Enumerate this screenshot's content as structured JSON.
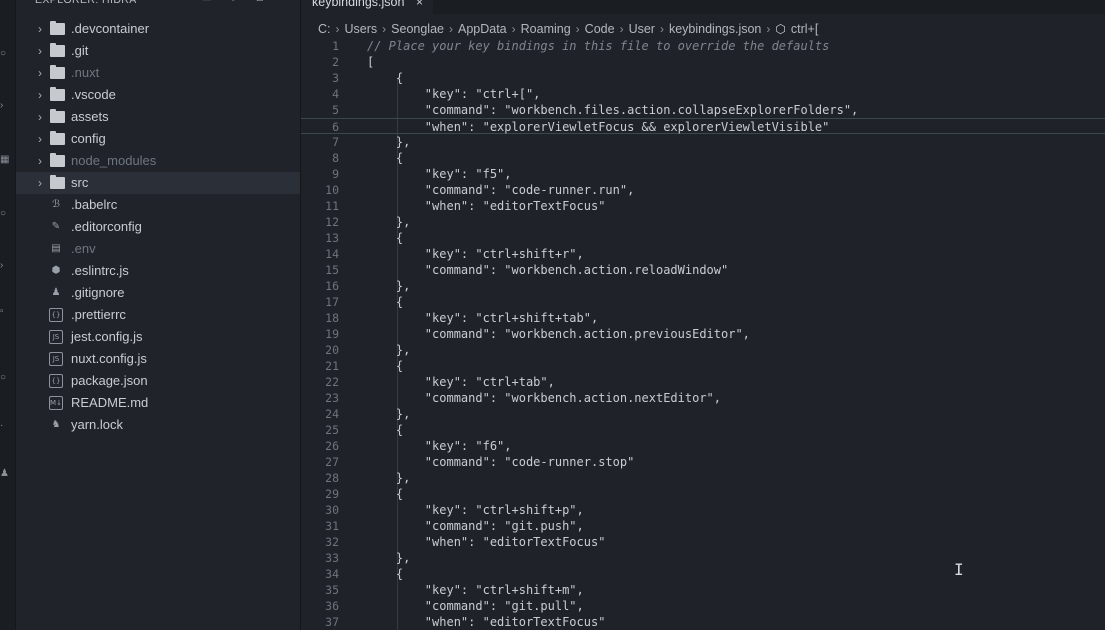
{
  "sidebar": {
    "title": "EXPLORER: HIDRA",
    "items": [
      {
        "label": ".devcontainer",
        "type": "folder",
        "dim": false
      },
      {
        "label": ".git",
        "type": "folder",
        "dim": false
      },
      {
        "label": ".nuxt",
        "type": "folder",
        "dim": true
      },
      {
        "label": ".vscode",
        "type": "folder",
        "dim": false
      },
      {
        "label": "assets",
        "type": "folder",
        "dim": false
      },
      {
        "label": "config",
        "type": "folder",
        "dim": false
      },
      {
        "label": "node_modules",
        "type": "folder",
        "dim": true
      },
      {
        "label": "src",
        "type": "folder",
        "dim": false,
        "selected": true
      },
      {
        "label": ".babelrc",
        "type": "file",
        "icon": "babel-icon",
        "glyph": "ℬ"
      },
      {
        "label": ".editorconfig",
        "type": "file",
        "icon": "editorconfig-icon",
        "glyph": "✎"
      },
      {
        "label": ".env",
        "type": "file",
        "icon": "env-file-icon",
        "glyph": "▤",
        "dim": true
      },
      {
        "label": ".eslintrc.js",
        "type": "file",
        "icon": "eslint-icon",
        "glyph": "⬢"
      },
      {
        "label": ".gitignore",
        "type": "file",
        "icon": "git-icon",
        "glyph": "♟"
      },
      {
        "label": ".prettierrc",
        "type": "file",
        "icon": "json-braces-icon",
        "glyph": "{}",
        "box": true
      },
      {
        "label": "jest.config.js",
        "type": "file",
        "icon": "js-file-icon",
        "glyph": "JS",
        "box": true
      },
      {
        "label": "nuxt.config.js",
        "type": "file",
        "icon": "js-file-icon",
        "glyph": "JS",
        "box": true
      },
      {
        "label": "package.json",
        "type": "file",
        "icon": "json-braces-icon",
        "glyph": "{}",
        "box": true
      },
      {
        "label": "README.md",
        "type": "file",
        "icon": "markdown-icon",
        "glyph": "M↓",
        "box": true
      },
      {
        "label": "yarn.lock",
        "type": "file",
        "icon": "yarn-icon",
        "glyph": "♞"
      }
    ]
  },
  "tab": {
    "label": "keybindings.json",
    "close": "×"
  },
  "breadcrumb": {
    "parts": [
      "C:",
      "Users",
      "Seonglae",
      "AppData",
      "Roaming",
      "Code",
      "User",
      "keybindings.json"
    ],
    "symbol": "ctrl+["
  },
  "editor": {
    "lines": [
      "// Place your key bindings in this file to override the defaults",
      "[",
      "    {",
      "        \"key\": \"ctrl+[\",",
      "        \"command\": \"workbench.files.action.collapseExplorerFolders\",",
      "        \"when\": \"explorerViewletFocus && explorerViewletVisible\"",
      "    },",
      "    {",
      "        \"key\": \"f5\",",
      "        \"command\": \"code-runner.run\",",
      "        \"when\": \"editorTextFocus\"",
      "    },",
      "    {",
      "        \"key\": \"ctrl+shift+r\",",
      "        \"command\": \"workbench.action.reloadWindow\"",
      "    },",
      "    {",
      "        \"key\": \"ctrl+shift+tab\",",
      "        \"command\": \"workbench.action.previousEditor\",",
      "    },",
      "    {",
      "        \"key\": \"ctrl+tab\",",
      "        \"command\": \"workbench.action.nextEditor\",",
      "    },",
      "    {",
      "        \"key\": \"f6\",",
      "        \"command\": \"code-runner.stop\"",
      "    },",
      "    {",
      "        \"key\": \"ctrl+shift+p\",",
      "        \"command\": \"git.push\",",
      "        \"when\": \"editorTextFocus\"",
      "    },",
      "    {",
      "        \"key\": \"ctrl+shift+m\",",
      "        \"command\": \"git.pull\",",
      "        \"when\": \"editorTextFocus\""
    ],
    "current_line": 6
  },
  "colors": {
    "background": "#1f2329",
    "sidebar": "#20242a",
    "selected_row": "#2b3038"
  }
}
